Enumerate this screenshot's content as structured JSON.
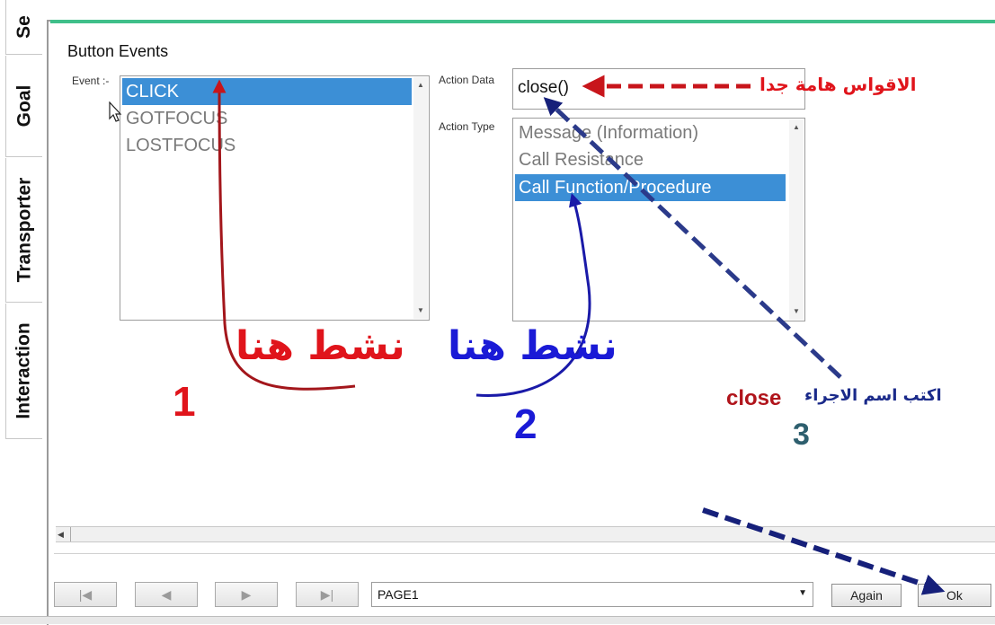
{
  "side_tabs": [
    {
      "label": "Se"
    },
    {
      "label": "Goal"
    },
    {
      "label": "Transporter"
    },
    {
      "label": "Interaction"
    }
  ],
  "panel": {
    "title": "Button Events",
    "event_label": "Event :-",
    "events": [
      "CLICK",
      "GOTFOCUS",
      "LOSTFOCUS"
    ],
    "selected_event": "CLICK",
    "action_data_label": "Action Data",
    "action_data_value": "close()",
    "action_type_label": "Action Type",
    "action_types": [
      "Message (Information)",
      "Call Resistance",
      "Call Function/Procedure"
    ],
    "selected_action_type": "Call Function/Procedure"
  },
  "footer": {
    "nav_first": "|◀",
    "nav_prev": "◀",
    "nav_next": "▶",
    "nav_last": "▶|",
    "page_select_value": "PAGE1",
    "again_label": "Again",
    "ok_label": "Ok"
  },
  "annotations": {
    "parentheses_note": "الاقواس هامة جدا",
    "activate_here_1": "نشط هنا",
    "activate_here_2": "نشط هنا",
    "write_proc_name": "اكتب اسم الاجراء",
    "proc_name": "close",
    "step1": "1",
    "step2": "2",
    "step3": "3"
  },
  "colors": {
    "selection": "#3c8fd6",
    "accent_green": "#3fbf8a",
    "annotation_red": "#e0141b",
    "annotation_blue": "#1a1ad6",
    "annotation_navy": "#1a2a8a",
    "annotation_teal": "#2e5f6e"
  }
}
